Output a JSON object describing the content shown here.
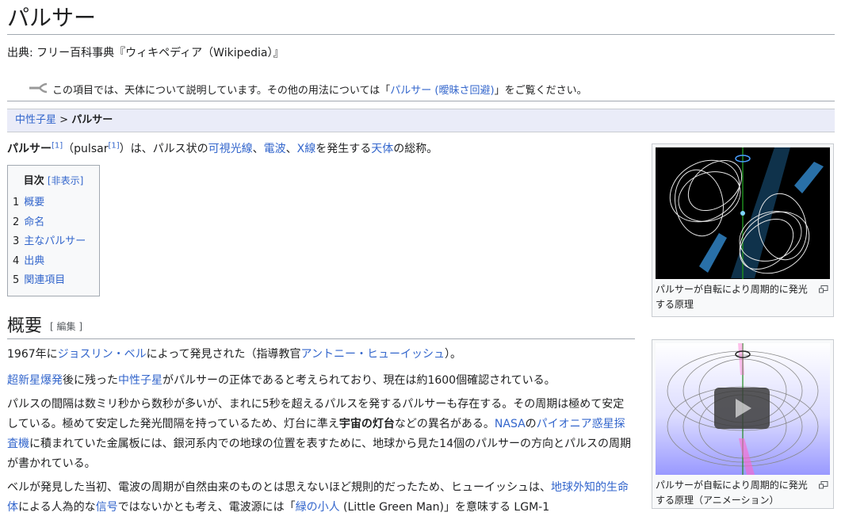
{
  "page": {
    "title": "パルサー",
    "source": "出典: フリー百科事典『ウィキペディア（Wikipedia）』"
  },
  "hatnote": {
    "icon": "disambiguation-icon",
    "prefix": "この項目では、天体について説明しています。その他の用法については「",
    "link": "パルサー (曖昧さ回避)",
    "suffix": "」をご覧ください。"
  },
  "breadcrumb": {
    "parent": "中性子星",
    "sep": " > ",
    "current": "パルサー"
  },
  "intro": {
    "term": "パルサー",
    "ref1": "[1]",
    "paren_open": "（pulsar",
    "ref2": "[1]",
    "paren_close": "）",
    "t1": "は、パルス状の",
    "l1": "可視光線",
    "c1": "、",
    "l2": "電波",
    "c2": "、",
    "l3": "X線",
    "t2": "を発生する",
    "l4": "天体",
    "t3": "の総称。"
  },
  "toc": {
    "title": "目次",
    "toggle": "[非表示]",
    "items": [
      {
        "num": "1",
        "label": "概要"
      },
      {
        "num": "2",
        "label": "命名"
      },
      {
        "num": "3",
        "label": "主なパルサー"
      },
      {
        "num": "4",
        "label": "出典"
      },
      {
        "num": "5",
        "label": "関連項目"
      }
    ]
  },
  "section": {
    "heading": "概要",
    "edit": "[ 編集 ]"
  },
  "paragraphs": {
    "p1": {
      "t1": "1967年に",
      "l1": "ジョスリン・ベル",
      "t2": "によって発見された（指導教官",
      "l2": "アントニー・ヒューイッシュ",
      "t3": "）。"
    },
    "p2": {
      "l1": "超新星爆発",
      "t1": "後に残った",
      "l2": "中性子星",
      "t2": "がパルサーの正体であると考えられており、現在は約1600個確認されている。"
    },
    "p3": {
      "t1": "パルスの間隔は数ミリ秒から数秒が多いが、まれに5秒を超えるパルスを発するパルサーも存在する。その周期は極めて安定している。極めて安定した発光間隔を持っているため、灯台に準え",
      "b1": "宇宙の灯台",
      "t2": "などの異名がある。",
      "l1": "NASA",
      "t3": "の",
      "l2": "パイオニア惑星探査機",
      "t4": "に積まれていた金属板には、銀河系内での地球の位置を表すために、地球から見た14個のパルサーの方向とパルスの周期が書かれている。"
    },
    "p4": {
      "t1": "ベルが発見した当初、電波の周期が自然由来のものとは思えないほど規則的だったため、ヒューイッシュは、",
      "l1": "地球外知的生命体",
      "t2": "による人為的な",
      "l2": "信号",
      "t3": "ではないかとも考え、電波源には「",
      "l3": "緑の小人",
      "t4": " (Little Green Man)」を意味する LGM-1"
    }
  },
  "thumbs": [
    {
      "caption": "パルサーが自転により周期的に発光する原理",
      "magnify_icon": "enlarge-icon"
    },
    {
      "caption": "パルサーが自転により周期的に発光する原理（アニメーション）",
      "magnify_icon": "enlarge-icon",
      "play_icon": "play-icon"
    }
  ],
  "colors": {
    "link": "#3366cc",
    "text": "#202122",
    "border": "#a2a9b1",
    "breadcrumb_bg": "#eaecf8"
  }
}
